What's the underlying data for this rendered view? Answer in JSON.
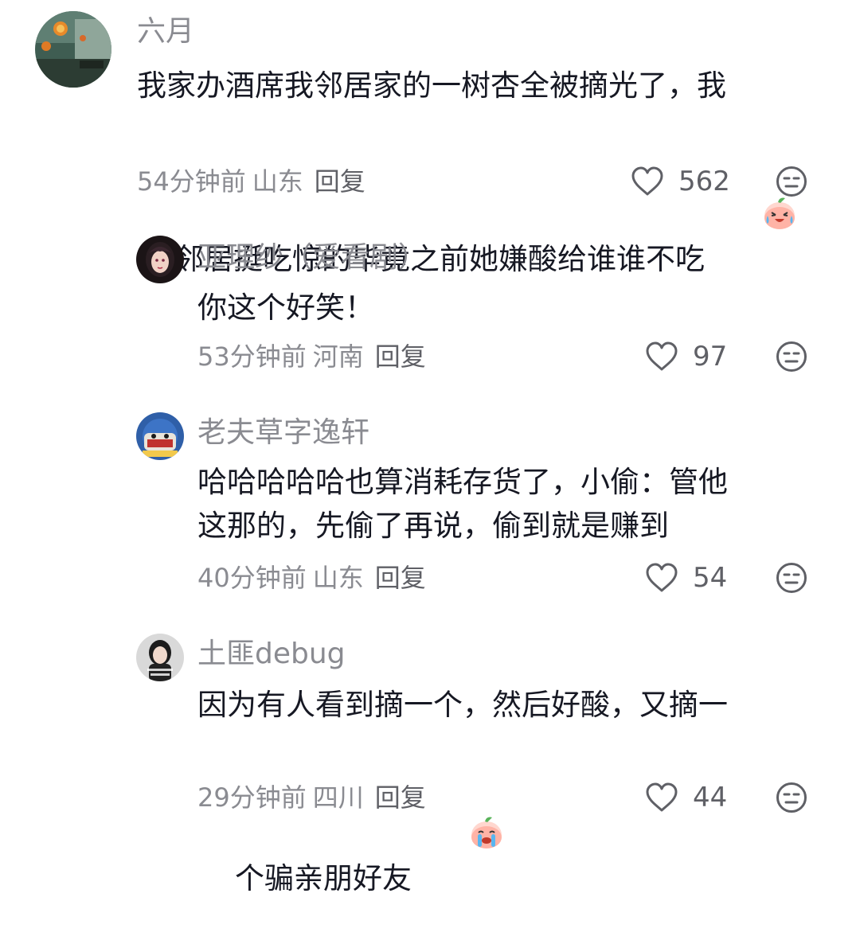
{
  "comments": [
    {
      "username": "六月",
      "line1": "我家办酒席我邻居家的一树杏全被摘光了，我",
      "line2": "邻居挺吃惊的毕竟之前她嫌酸给谁谁不吃",
      "time": "54分钟前",
      "location": "山东",
      "reply": "回复",
      "likes": "562",
      "emoji": "laughing-crying-peach"
    },
    {
      "username": "亚理纱（爱看剧）",
      "line1": "你这个好笑！",
      "line2": "",
      "time": "53分钟前",
      "location": "河南",
      "reply": "回复",
      "likes": "97"
    },
    {
      "username": "老夫草字逸轩",
      "line1": "哈哈哈哈哈也算消耗存货了，小偷：管他",
      "line2": "这那的，先偷了再说，偷到就是赚到",
      "time": "40分钟前",
      "location": "山东",
      "reply": "回复",
      "likes": "54"
    },
    {
      "username": "土匪debug",
      "line1": "因为有人看到摘一个，然后好酸，又摘一",
      "line2": "个骗亲朋好友",
      "time": "29分钟前",
      "location": "四川",
      "reply": "回复",
      "likes": "44",
      "emoji": "crying-peach"
    }
  ],
  "colors": {
    "text": "#161823",
    "meta": "#8a8b91",
    "icon": "#5f6066"
  },
  "icons": {
    "like": "heart-outline-icon",
    "dislike": "meh-face-icon"
  }
}
